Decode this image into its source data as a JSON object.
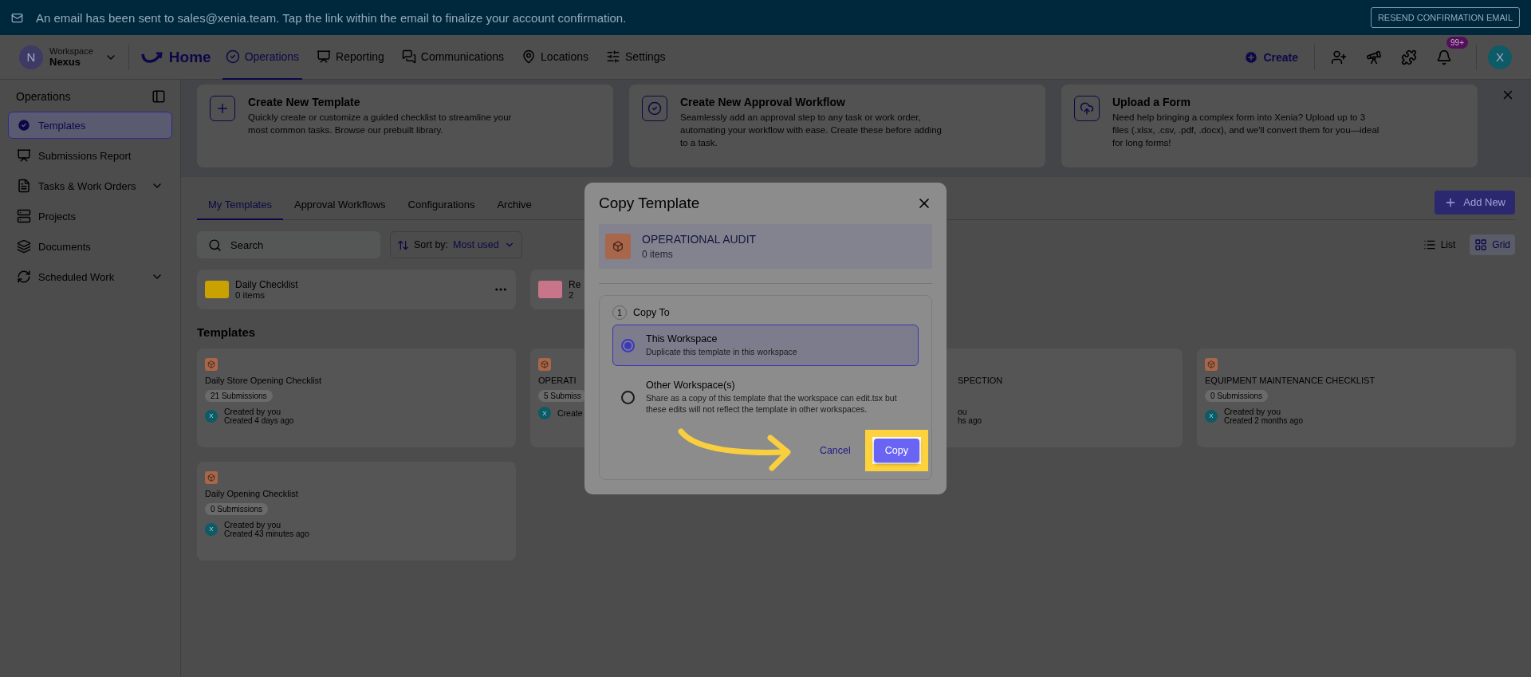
{
  "banner": {
    "message": "An email has been sent to sales@xenia.team. Tap the link within the email to finalize your account confirmation.",
    "button": "RESEND CONFIRMATION EMAIL"
  },
  "nav": {
    "avatar": "N",
    "workspace_label": "Workspace",
    "workspace_name": "Nexus",
    "home": "Home",
    "items": [
      {
        "label": "Operations",
        "selected": true
      },
      {
        "label": "Reporting",
        "selected": false
      },
      {
        "label": "Communications",
        "selected": false
      },
      {
        "label": "Locations",
        "selected": false
      },
      {
        "label": "Settings",
        "selected": false
      }
    ],
    "create": "Create",
    "badge": "99+",
    "user_avatar": "X"
  },
  "sidebar": {
    "title": "Operations",
    "items": [
      {
        "label": "Templates",
        "selected": true,
        "expandable": false
      },
      {
        "label": "Submissions Report",
        "selected": false,
        "expandable": false
      },
      {
        "label": "Tasks & Work Orders",
        "selected": false,
        "expandable": true
      },
      {
        "label": "Projects",
        "selected": false,
        "expandable": false
      },
      {
        "label": "Documents",
        "selected": false,
        "expandable": false
      },
      {
        "label": "Scheduled Work",
        "selected": false,
        "expandable": true
      }
    ]
  },
  "info_cards": [
    {
      "title": "Create New Template",
      "text": "Quickly create or customize a guided checklist to streamline your most common tasks. Browse our prebuilt library."
    },
    {
      "title": "Create New Approval Workflow",
      "text": "Seamlessly add an approval step to any task or work order, automating your workflow with ease. Create these before adding to a task."
    },
    {
      "title": "Upload a Form",
      "text": "Need help bringing a complex form into Xenia? Upload up to 3 files (.xlsx, .csv, .pdf, .docx), and we'll convert them for you—ideal for long forms!"
    }
  ],
  "tabs": [
    {
      "label": "My Templates",
      "selected": true
    },
    {
      "label": "Approval Workflows",
      "selected": false
    },
    {
      "label": "Configurations",
      "selected": false
    },
    {
      "label": "Archive",
      "selected": false
    }
  ],
  "add_button": "Add New",
  "search": {
    "placeholder": "Search"
  },
  "sort": {
    "label": "Sort by:",
    "value": "Most used"
  },
  "views": [
    {
      "label": "List",
      "selected": false
    },
    {
      "label": "Grid",
      "selected": true
    }
  ],
  "folders": [
    {
      "name": "Daily Checklist",
      "count": "0 items",
      "color": "#c9a100"
    },
    {
      "name": "Re",
      "count": "2",
      "color": "#c8758a"
    }
  ],
  "templates_heading": "Templates",
  "templates": [
    {
      "title": "Daily Store Opening Checklist",
      "submissions": "21 Submissions",
      "avatar": "X",
      "creator": "Created by you",
      "created": "Created 4 days ago",
      "offset": false
    },
    {
      "title": "OPERATI",
      "submissions": "5 Submiss",
      "avatar": "X",
      "creator": "Create",
      "offset": false
    },
    {
      "title": "SPECTION",
      "creator": "ou",
      "created": "hs ago",
      "offset": true
    },
    {
      "title": "EQUIPMENT MAINTENANCE CHECKLIST",
      "submissions": "0 Submissions",
      "avatar": "X",
      "creator": "Created by you",
      "created": "Created 2 months ago",
      "offset": false
    },
    {
      "title": "Daily Opening Checklist",
      "submissions": "0 Submissions",
      "avatar": "X",
      "creator": "Created by you",
      "created": "Created 43 minutes ago",
      "offset": false
    }
  ],
  "modal": {
    "title": "Copy Template",
    "item_title": "OPERATIONAL AUDIT",
    "item_count": "0 items",
    "step": "1",
    "section": "Copy To",
    "options": [
      {
        "title": "This Workspace",
        "text": "Duplicate this template in this workspace",
        "selected": true
      },
      {
        "title": "Other Workspace(s)",
        "text": "Share as a copy of this template that the workspace can edit.tsx but these edits will not reflect the template in other workspaces.",
        "selected": false
      }
    ],
    "cancel": "Cancel",
    "confirm": "Copy"
  }
}
